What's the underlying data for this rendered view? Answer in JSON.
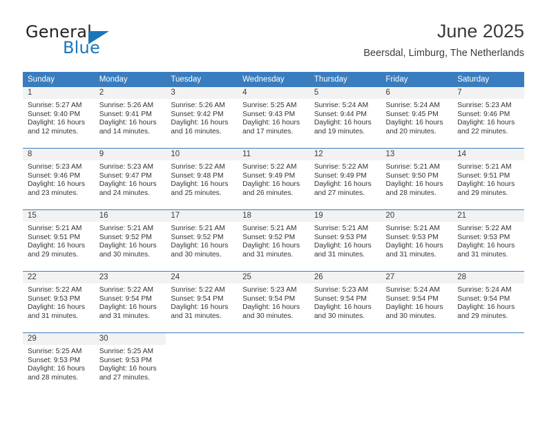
{
  "brand": {
    "name_top": "General",
    "name_bottom": "Blue",
    "accent_color": "#1b75bb",
    "logo_icon": "triangle-flag-icon"
  },
  "header": {
    "title": "June 2025",
    "location": "Beersdal, Limburg, The Netherlands"
  },
  "calendar": {
    "header_bg": "#3a7dbf",
    "daynum_bg": "#f2f2f2",
    "weekdays": [
      "Sunday",
      "Monday",
      "Tuesday",
      "Wednesday",
      "Thursday",
      "Friday",
      "Saturday"
    ],
    "weeks": [
      [
        {
          "day": "1",
          "sunrise": "Sunrise: 5:27 AM",
          "sunset": "Sunset: 9:40 PM",
          "daylight1": "Daylight: 16 hours",
          "daylight2": "and 12 minutes."
        },
        {
          "day": "2",
          "sunrise": "Sunrise: 5:26 AM",
          "sunset": "Sunset: 9:41 PM",
          "daylight1": "Daylight: 16 hours",
          "daylight2": "and 14 minutes."
        },
        {
          "day": "3",
          "sunrise": "Sunrise: 5:26 AM",
          "sunset": "Sunset: 9:42 PM",
          "daylight1": "Daylight: 16 hours",
          "daylight2": "and 16 minutes."
        },
        {
          "day": "4",
          "sunrise": "Sunrise: 5:25 AM",
          "sunset": "Sunset: 9:43 PM",
          "daylight1": "Daylight: 16 hours",
          "daylight2": "and 17 minutes."
        },
        {
          "day": "5",
          "sunrise": "Sunrise: 5:24 AM",
          "sunset": "Sunset: 9:44 PM",
          "daylight1": "Daylight: 16 hours",
          "daylight2": "and 19 minutes."
        },
        {
          "day": "6",
          "sunrise": "Sunrise: 5:24 AM",
          "sunset": "Sunset: 9:45 PM",
          "daylight1": "Daylight: 16 hours",
          "daylight2": "and 20 minutes."
        },
        {
          "day": "7",
          "sunrise": "Sunrise: 5:23 AM",
          "sunset": "Sunset: 9:46 PM",
          "daylight1": "Daylight: 16 hours",
          "daylight2": "and 22 minutes."
        }
      ],
      [
        {
          "day": "8",
          "sunrise": "Sunrise: 5:23 AM",
          "sunset": "Sunset: 9:46 PM",
          "daylight1": "Daylight: 16 hours",
          "daylight2": "and 23 minutes."
        },
        {
          "day": "9",
          "sunrise": "Sunrise: 5:23 AM",
          "sunset": "Sunset: 9:47 PM",
          "daylight1": "Daylight: 16 hours",
          "daylight2": "and 24 minutes."
        },
        {
          "day": "10",
          "sunrise": "Sunrise: 5:22 AM",
          "sunset": "Sunset: 9:48 PM",
          "daylight1": "Daylight: 16 hours",
          "daylight2": "and 25 minutes."
        },
        {
          "day": "11",
          "sunrise": "Sunrise: 5:22 AM",
          "sunset": "Sunset: 9:49 PM",
          "daylight1": "Daylight: 16 hours",
          "daylight2": "and 26 minutes."
        },
        {
          "day": "12",
          "sunrise": "Sunrise: 5:22 AM",
          "sunset": "Sunset: 9:49 PM",
          "daylight1": "Daylight: 16 hours",
          "daylight2": "and 27 minutes."
        },
        {
          "day": "13",
          "sunrise": "Sunrise: 5:21 AM",
          "sunset": "Sunset: 9:50 PM",
          "daylight1": "Daylight: 16 hours",
          "daylight2": "and 28 minutes."
        },
        {
          "day": "14",
          "sunrise": "Sunrise: 5:21 AM",
          "sunset": "Sunset: 9:51 PM",
          "daylight1": "Daylight: 16 hours",
          "daylight2": "and 29 minutes."
        }
      ],
      [
        {
          "day": "15",
          "sunrise": "Sunrise: 5:21 AM",
          "sunset": "Sunset: 9:51 PM",
          "daylight1": "Daylight: 16 hours",
          "daylight2": "and 29 minutes."
        },
        {
          "day": "16",
          "sunrise": "Sunrise: 5:21 AM",
          "sunset": "Sunset: 9:52 PM",
          "daylight1": "Daylight: 16 hours",
          "daylight2": "and 30 minutes."
        },
        {
          "day": "17",
          "sunrise": "Sunrise: 5:21 AM",
          "sunset": "Sunset: 9:52 PM",
          "daylight1": "Daylight: 16 hours",
          "daylight2": "and 30 minutes."
        },
        {
          "day": "18",
          "sunrise": "Sunrise: 5:21 AM",
          "sunset": "Sunset: 9:52 PM",
          "daylight1": "Daylight: 16 hours",
          "daylight2": "and 31 minutes."
        },
        {
          "day": "19",
          "sunrise": "Sunrise: 5:21 AM",
          "sunset": "Sunset: 9:53 PM",
          "daylight1": "Daylight: 16 hours",
          "daylight2": "and 31 minutes."
        },
        {
          "day": "20",
          "sunrise": "Sunrise: 5:21 AM",
          "sunset": "Sunset: 9:53 PM",
          "daylight1": "Daylight: 16 hours",
          "daylight2": "and 31 minutes."
        },
        {
          "day": "21",
          "sunrise": "Sunrise: 5:22 AM",
          "sunset": "Sunset: 9:53 PM",
          "daylight1": "Daylight: 16 hours",
          "daylight2": "and 31 minutes."
        }
      ],
      [
        {
          "day": "22",
          "sunrise": "Sunrise: 5:22 AM",
          "sunset": "Sunset: 9:53 PM",
          "daylight1": "Daylight: 16 hours",
          "daylight2": "and 31 minutes."
        },
        {
          "day": "23",
          "sunrise": "Sunrise: 5:22 AM",
          "sunset": "Sunset: 9:54 PM",
          "daylight1": "Daylight: 16 hours",
          "daylight2": "and 31 minutes."
        },
        {
          "day": "24",
          "sunrise": "Sunrise: 5:22 AM",
          "sunset": "Sunset: 9:54 PM",
          "daylight1": "Daylight: 16 hours",
          "daylight2": "and 31 minutes."
        },
        {
          "day": "25",
          "sunrise": "Sunrise: 5:23 AM",
          "sunset": "Sunset: 9:54 PM",
          "daylight1": "Daylight: 16 hours",
          "daylight2": "and 30 minutes."
        },
        {
          "day": "26",
          "sunrise": "Sunrise: 5:23 AM",
          "sunset": "Sunset: 9:54 PM",
          "daylight1": "Daylight: 16 hours",
          "daylight2": "and 30 minutes."
        },
        {
          "day": "27",
          "sunrise": "Sunrise: 5:24 AM",
          "sunset": "Sunset: 9:54 PM",
          "daylight1": "Daylight: 16 hours",
          "daylight2": "and 30 minutes."
        },
        {
          "day": "28",
          "sunrise": "Sunrise: 5:24 AM",
          "sunset": "Sunset: 9:54 PM",
          "daylight1": "Daylight: 16 hours",
          "daylight2": "and 29 minutes."
        }
      ],
      [
        {
          "day": "29",
          "sunrise": "Sunrise: 5:25 AM",
          "sunset": "Sunset: 9:53 PM",
          "daylight1": "Daylight: 16 hours",
          "daylight2": "and 28 minutes."
        },
        {
          "day": "30",
          "sunrise": "Sunrise: 5:25 AM",
          "sunset": "Sunset: 9:53 PM",
          "daylight1": "Daylight: 16 hours",
          "daylight2": "and 27 minutes."
        },
        {
          "day": "",
          "sunrise": "",
          "sunset": "",
          "daylight1": "",
          "daylight2": ""
        },
        {
          "day": "",
          "sunrise": "",
          "sunset": "",
          "daylight1": "",
          "daylight2": ""
        },
        {
          "day": "",
          "sunrise": "",
          "sunset": "",
          "daylight1": "",
          "daylight2": ""
        },
        {
          "day": "",
          "sunrise": "",
          "sunset": "",
          "daylight1": "",
          "daylight2": ""
        },
        {
          "day": "",
          "sunrise": "",
          "sunset": "",
          "daylight1": "",
          "daylight2": ""
        }
      ]
    ]
  }
}
